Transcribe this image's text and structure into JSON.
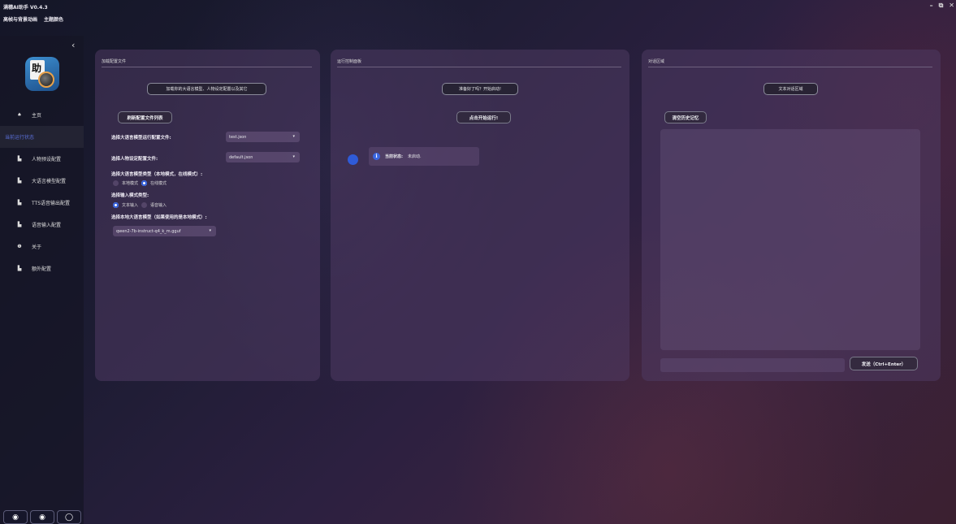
{
  "window": {
    "title": "满穗AI助手 V0.4.3",
    "menu": [
      "高帧与背景动画",
      "主题颜色"
    ],
    "controls": [
      "–",
      "⧉",
      "✕"
    ]
  },
  "sidebar": {
    "collapse_icon": "‹",
    "items": [
      {
        "label": "主页",
        "icon": "home-icon",
        "glyph": "♠"
      },
      {
        "label": "当前运行状态",
        "icon": "",
        "glyph": "",
        "active": true
      },
      {
        "label": "人物预设配置",
        "icon": "document-icon",
        "glyph": "▙"
      },
      {
        "label": "大语言模型配置",
        "icon": "document-icon",
        "glyph": "▙"
      },
      {
        "label": "TTS语音输出配置",
        "icon": "document-icon",
        "glyph": "▙"
      },
      {
        "label": "语音输入配置",
        "icon": "document-icon",
        "glyph": "▙"
      },
      {
        "label": "关于",
        "icon": "info-icon",
        "glyph": "❶"
      },
      {
        "label": "额外配置",
        "icon": "document-icon",
        "glyph": "▙"
      }
    ],
    "bottom_buttons": [
      {
        "name": "discord-button",
        "glyph": "◉"
      },
      {
        "name": "chat-button",
        "glyph": "◉"
      },
      {
        "name": "github-button",
        "glyph": "◯"
      }
    ]
  },
  "config_panel": {
    "title": "加载配置文件",
    "hint": "加载你的大语言模型、人物设定配置以及其它",
    "refresh_button": "刷新配置文件列表",
    "llm_config_label": "选择大语言模型运行配置文件:",
    "llm_config_value": "test.json",
    "persona_label": "选择人物设定配置文件:",
    "persona_value": "default.json",
    "model_type_label": "选择大语言模型类型（本地模式，在线模式）:",
    "model_type_options": [
      {
        "label": "本地模式",
        "selected": false
      },
      {
        "label": "在线模式",
        "selected": true
      }
    ],
    "input_mode_label": "选择输入模式类型:",
    "input_mode_options": [
      {
        "label": "文本输入",
        "selected": true
      },
      {
        "label": "语音输入",
        "selected": false
      }
    ],
    "local_model_label": "选择本地大语言模型（如果使用的是本地模式）:",
    "local_model_value": "qwen2-7b-instruct-q4_k_m.gguf",
    "dropdown_arrow": "▾"
  },
  "control_panel": {
    "title": "运行控制面板",
    "hint": "准备好了吗？开始启动!",
    "start_button": "点击开始运行!",
    "status_key": "当前状态:",
    "status_value": "未启动."
  },
  "chat_panel": {
    "title": "对话区域",
    "hint": "文本对话区域",
    "clear_button": "清空历史记忆",
    "input_value": "",
    "send_button": "发送（Ctrl+Enter）"
  },
  "colors": {
    "accent": "#2f5bd8",
    "active_nav_text": "#5a6fd8",
    "panel_bg": "#4e3a62"
  }
}
